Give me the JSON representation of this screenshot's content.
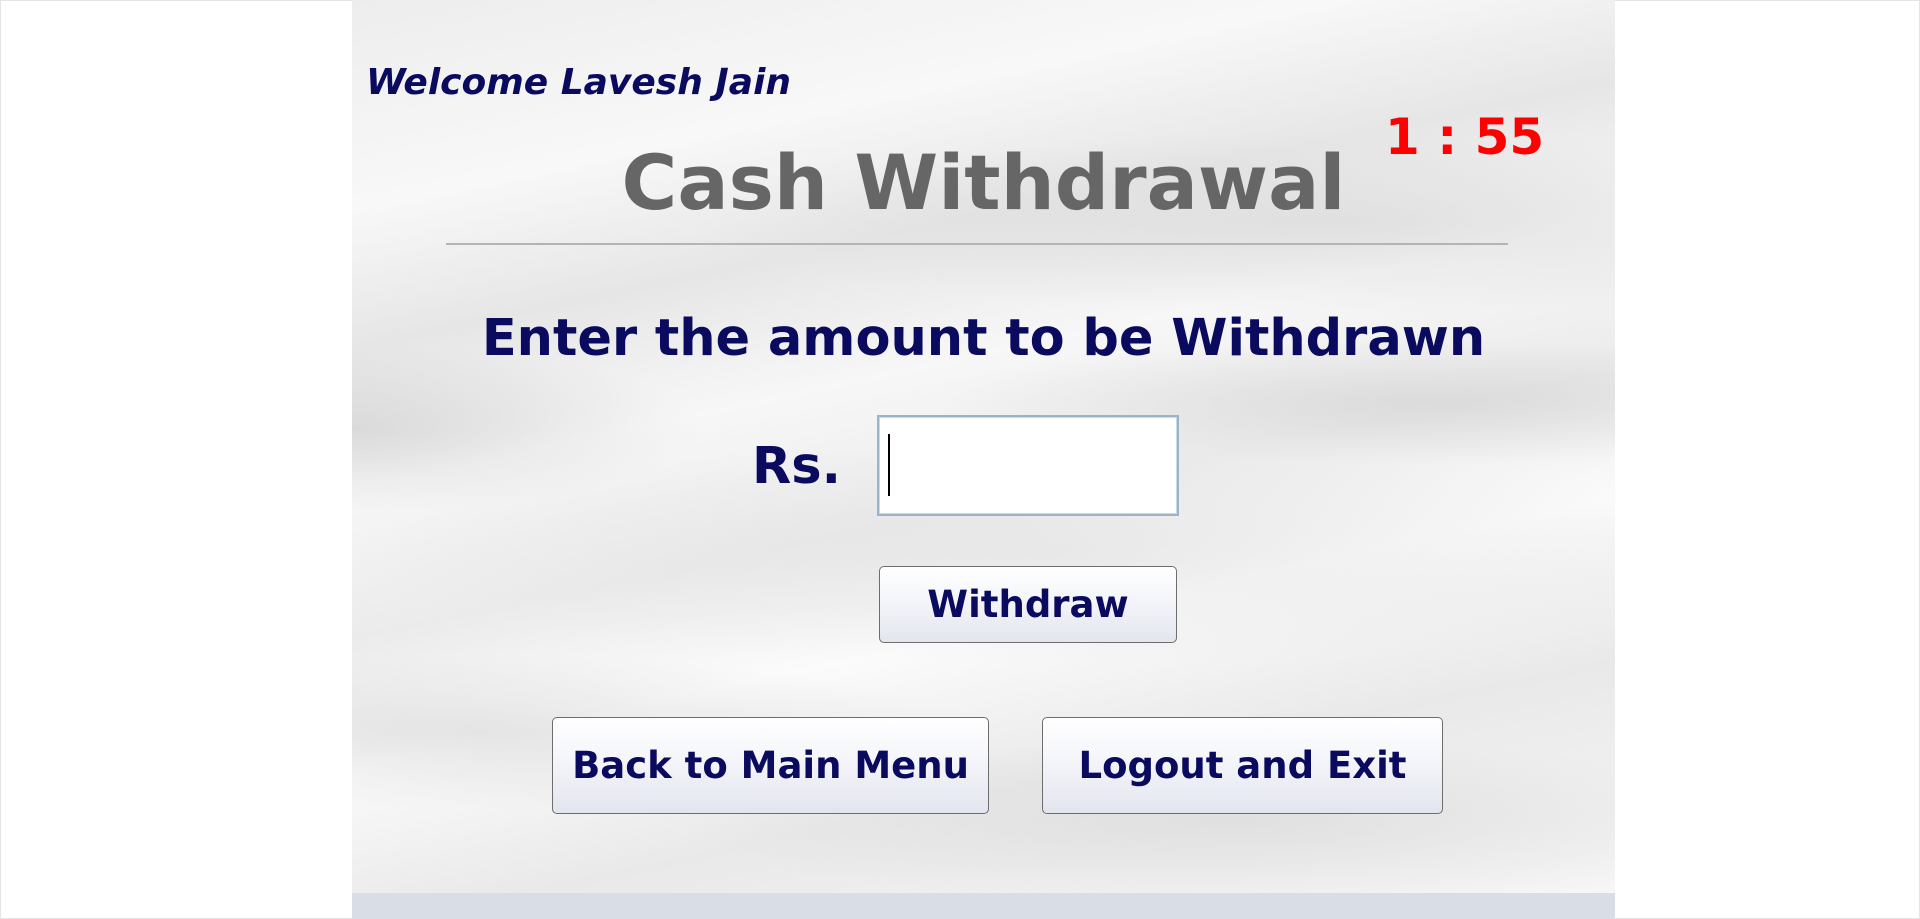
{
  "header": {
    "welcome_text": "Welcome Lavesh Jain",
    "timer_text": "1 : 55",
    "timer_color": "#ff0000"
  },
  "main": {
    "title": "Cash Withdrawal",
    "prompt": "Enter the amount to be Withdrawn",
    "currency_label": "Rs.",
    "amount_input": {
      "value": "",
      "placeholder": ""
    },
    "withdraw_button_label": "Withdraw"
  },
  "footer_buttons": {
    "back_label": "Back to Main Menu",
    "logout_label": "Logout and Exit"
  },
  "colors": {
    "text_navy": "#0a0a5e",
    "title_gray": "#666666",
    "footer_strip": "#d9dde6"
  }
}
